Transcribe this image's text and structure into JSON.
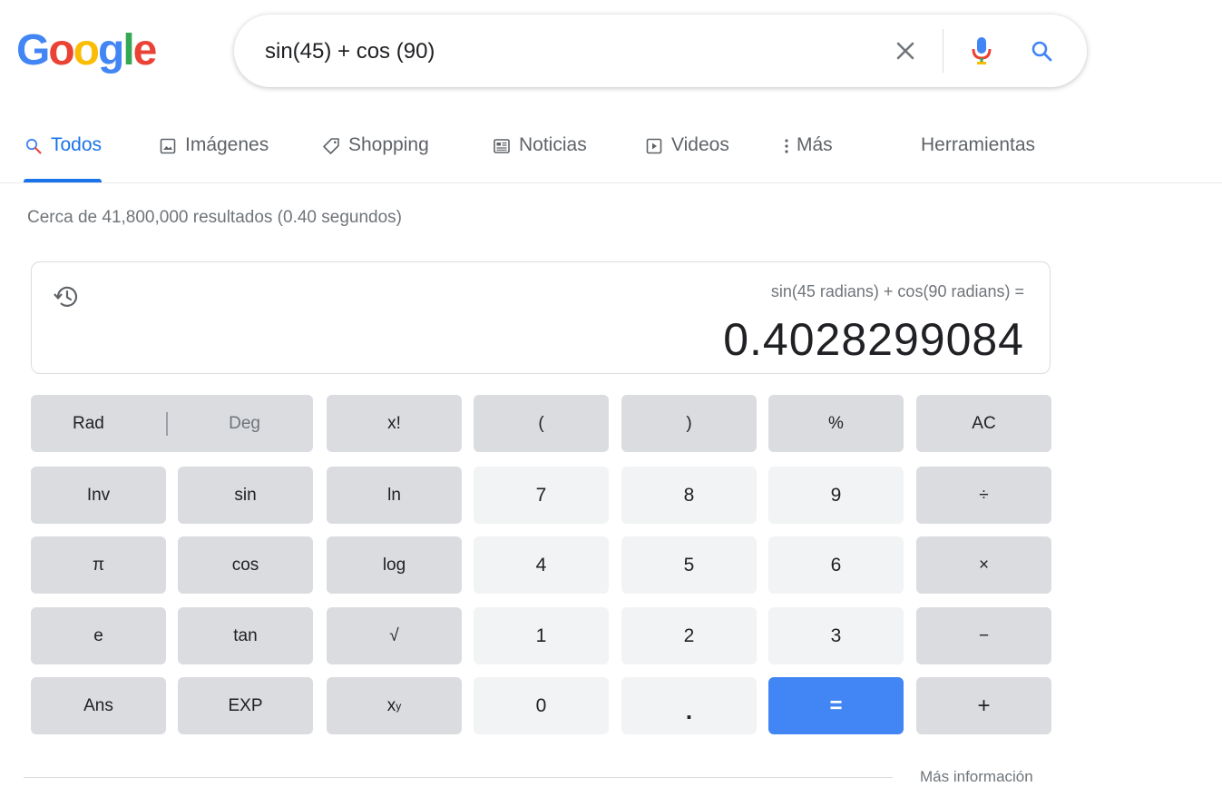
{
  "logo": {
    "letters": [
      "G",
      "o",
      "o",
      "g",
      "l",
      "e"
    ],
    "colors": [
      "#4285f4",
      "#ea4335",
      "#fbbc05",
      "#4285f4",
      "#34a853",
      "#ea4335"
    ]
  },
  "search": {
    "query": "sin(45) + cos (90)",
    "icons": {
      "clear": "close-icon",
      "voice": "mic-icon",
      "submit": "search-icon"
    }
  },
  "tabs": [
    {
      "label": "Todos",
      "icon": "search-icon",
      "active": true
    },
    {
      "label": "Imágenes",
      "icon": "image-icon"
    },
    {
      "label": "Shopping",
      "icon": "tag-icon"
    },
    {
      "label": "Noticias",
      "icon": "news-icon"
    },
    {
      "label": "Videos",
      "icon": "play-icon"
    },
    {
      "label": "Más",
      "icon": "more-vert-icon"
    },
    {
      "label": "Herramientas"
    }
  ],
  "stats": "Cerca de 41,800,000 resultados (0.40 segundos)",
  "calculator": {
    "expression": "sin(45 radians) + cos(90 radians) =",
    "result": "0.4028299084",
    "mode": {
      "rad": "Rad",
      "deg": "Deg",
      "active": "Rad"
    },
    "keys": {
      "fact": "x!",
      "lparen": "(",
      "rparen": ")",
      "percent": "%",
      "ac": "AC",
      "inv": "Inv",
      "sin": "sin",
      "ln": "ln",
      "n7": "7",
      "n8": "8",
      "n9": "9",
      "div": "÷",
      "pi": "π",
      "cos": "cos",
      "log": "log",
      "n4": "4",
      "n5": "5",
      "n6": "6",
      "mul": "×",
      "e": "e",
      "tan": "tan",
      "sqrt": "√",
      "n1": "1",
      "n2": "2",
      "n3": "3",
      "sub": "−",
      "ans": "Ans",
      "exp": "EXP",
      "pow_base": "x",
      "pow_sup": "y",
      "n0": "0",
      "dot": ".",
      "eq": "=",
      "add": "+"
    },
    "accent": "#4285f4"
  },
  "footer": {
    "more_info": "Más información"
  }
}
